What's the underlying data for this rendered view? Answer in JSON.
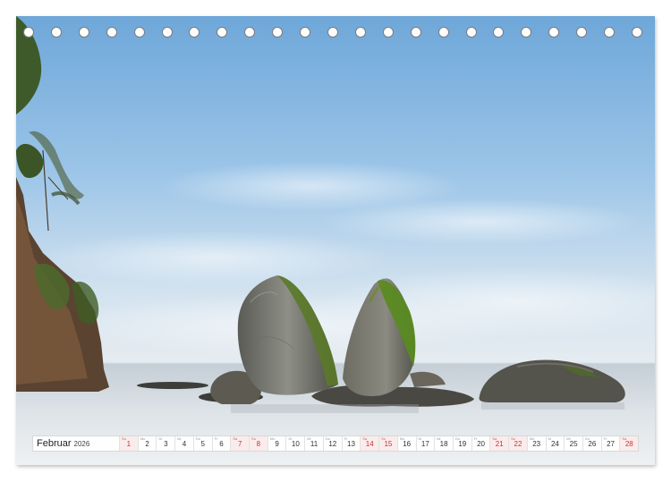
{
  "calendar": {
    "month": "Februar",
    "year": "2026",
    "days": [
      {
        "wd": "So",
        "n": "1",
        "we": true
      },
      {
        "wd": "Mo",
        "n": "2",
        "we": false
      },
      {
        "wd": "Di",
        "n": "3",
        "we": false
      },
      {
        "wd": "Mi",
        "n": "4",
        "we": false
      },
      {
        "wd": "Do",
        "n": "5",
        "we": false
      },
      {
        "wd": "Fr",
        "n": "6",
        "we": false
      },
      {
        "wd": "Sa",
        "n": "7",
        "we": true
      },
      {
        "wd": "So",
        "n": "8",
        "we": true
      },
      {
        "wd": "Mo",
        "n": "9",
        "we": false
      },
      {
        "wd": "Di",
        "n": "10",
        "we": false
      },
      {
        "wd": "Mi",
        "n": "11",
        "we": false
      },
      {
        "wd": "Do",
        "n": "12",
        "we": false
      },
      {
        "wd": "Fr",
        "n": "13",
        "we": false
      },
      {
        "wd": "Sa",
        "n": "14",
        "we": true
      },
      {
        "wd": "So",
        "n": "15",
        "we": true
      },
      {
        "wd": "Mo",
        "n": "16",
        "we": false
      },
      {
        "wd": "Di",
        "n": "17",
        "we": false
      },
      {
        "wd": "Mi",
        "n": "18",
        "we": false
      },
      {
        "wd": "Do",
        "n": "19",
        "we": false
      },
      {
        "wd": "Fr",
        "n": "20",
        "we": false
      },
      {
        "wd": "Sa",
        "n": "21",
        "we": true
      },
      {
        "wd": "So",
        "n": "22",
        "we": true
      },
      {
        "wd": "Mo",
        "n": "23",
        "we": false
      },
      {
        "wd": "Di",
        "n": "24",
        "we": false
      },
      {
        "wd": "Mi",
        "n": "25",
        "we": false
      },
      {
        "wd": "Do",
        "n": "26",
        "we": false
      },
      {
        "wd": "Fr",
        "n": "27",
        "we": false
      },
      {
        "wd": "Sa",
        "n": "28",
        "we": true
      }
    ]
  },
  "binding": {
    "hole_count": 23
  }
}
